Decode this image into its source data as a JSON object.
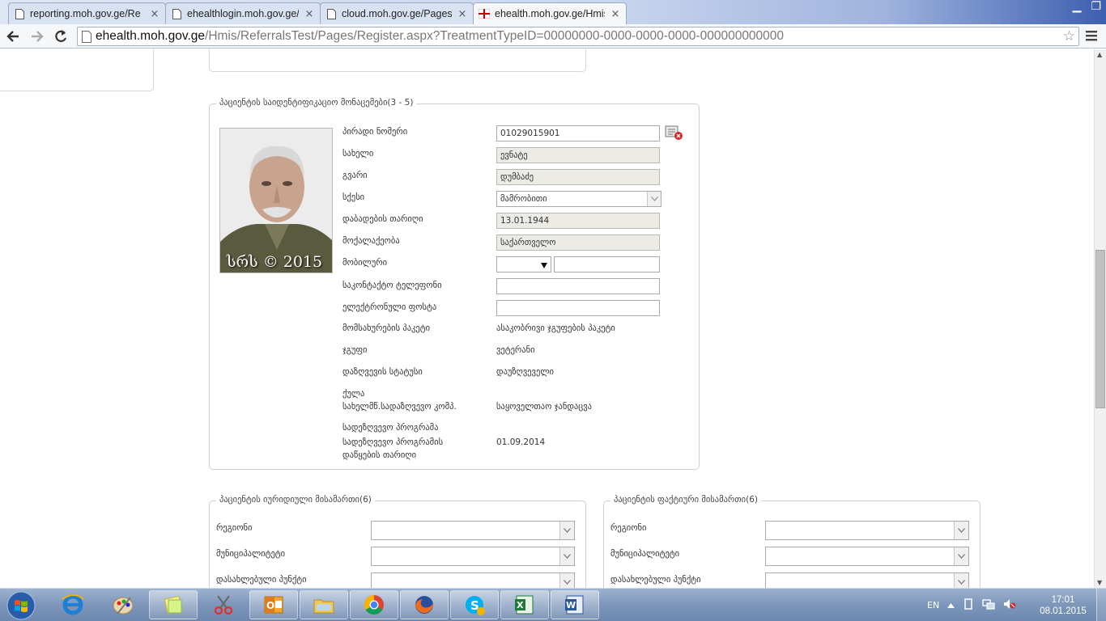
{
  "browser": {
    "tabs": [
      {
        "title": "reporting.moh.gov.ge/Re",
        "active": false
      },
      {
        "title": "ehealthlogin.moh.gov.ge/",
        "active": false
      },
      {
        "title": "cloud.moh.gov.ge/Pages/",
        "active": false
      },
      {
        "title": "ehealth.moh.gov.ge/Hmis",
        "active": true
      }
    ],
    "close_glyph": "×",
    "url_host": "ehealth.moh.gov.ge",
    "url_path": "/Hmis/ReferralsTest/Pages/Register.aspx?TreatmentTypeID=00000000-0000-0000-0000-000000000000"
  },
  "patient": {
    "legend": "პაციენტის საიდენტიფიკაციო მონაცემები(3 - 5)",
    "photo_caption": "სრს © 2015",
    "personal_number_label": "პირადი ნომერი",
    "personal_number": "01029015901",
    "first_name_label": "სახელი",
    "first_name": "ევნატე",
    "last_name_label": "გვარი",
    "last_name": "დუმბაძე",
    "gender_label": "სქესი",
    "gender": "მამრობითი",
    "birth_date_label": "დაბადების თარიღი",
    "birth_date": "13.01.1944",
    "citizenship_label": "მოქალაქეობა",
    "citizenship": "საქართველო",
    "mobile_label": "მობილური",
    "mobile_prefix": "",
    "mobile_number": "",
    "contact_phone_label": "საკონტაქტო ტელეფონი",
    "contact_phone": "",
    "email_label": "ელექტრონული ფოსტა",
    "email": "",
    "service_package_label": "მომსახურების პაკეტი",
    "service_package": "ასაკობრივი ჯგუფების პაკეტი",
    "group_label": "ჯგუფი",
    "group": "ვეტერანი",
    "insurance_status_label": "დაზღვევის სტატუსი",
    "insurance_status": "დაუზღვეველი",
    "score_label": "ქულა",
    "insurer_label": "სახელმწ.სადაზღვევო კომპ.",
    "insurer": "საყოველთაო ჯანდაცვა",
    "program_label": "სადეზღვევო პროგრამა",
    "program_start_label": "სადეზღვევო პროგრამის დაწყების თარიღი",
    "program_start": "01.09.2014"
  },
  "address_legal": {
    "legend": "პაციენტის იურიდიული მისამართი(6)",
    "region_label": "რეგიონი",
    "municipality_label": "მუნიციპალიტეტი",
    "settlement_label": "დასახლებული პუნქტი"
  },
  "address_actual": {
    "legend": "პაციენტის ფაქტიური მისამართი(6)",
    "region_label": "რეგიონი",
    "municipality_label": "მუნიციპალიტეტი",
    "settlement_label": "დასახლებული პუნქტი"
  },
  "taskbar": {
    "apps": [
      "internet-explorer",
      "paint",
      "sticky-notes",
      "snipping-tool",
      "outlook",
      "file-explorer",
      "chrome",
      "firefox",
      "skype",
      "excel",
      "word"
    ],
    "language": "EN",
    "time": "17:01",
    "date": "08.01.2015"
  }
}
